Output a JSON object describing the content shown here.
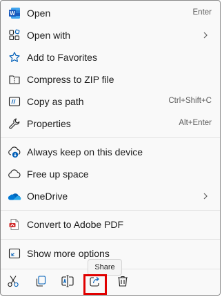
{
  "menu": {
    "items": [
      {
        "label": "Open",
        "shortcut": "Enter",
        "icon": "word-icon"
      },
      {
        "label": "Open with",
        "icon": "apps-grid-icon",
        "submenu": true
      },
      {
        "label": "Add to Favorites",
        "icon": "star-icon"
      },
      {
        "label": "Compress to ZIP file",
        "icon": "zip-folder-icon"
      },
      {
        "label": "Copy as path",
        "shortcut": "Ctrl+Shift+C",
        "icon": "copy-path-icon"
      },
      {
        "label": "Properties",
        "shortcut": "Alt+Enter",
        "icon": "wrench-icon"
      },
      {
        "label": "Always keep on this device",
        "icon": "cloud-download-icon"
      },
      {
        "label": "Free up space",
        "icon": "cloud-icon"
      },
      {
        "label": "OneDrive",
        "icon": "onedrive-icon",
        "submenu": true
      },
      {
        "label": "Convert to Adobe PDF",
        "icon": "adobe-pdf-icon"
      },
      {
        "label": "Show more options",
        "icon": "more-options-icon"
      }
    ]
  },
  "toolbar": {
    "tooltip": "Share",
    "buttons": [
      "cut-icon",
      "copy-icon",
      "rename-icon",
      "share-icon",
      "delete-icon"
    ]
  },
  "colors": {
    "accent": "#005fb8",
    "highlight": "#e00000",
    "word_blue": "#185abd",
    "onedrive_blue": "#0364b8",
    "pdf_red": "#d12a2a"
  }
}
